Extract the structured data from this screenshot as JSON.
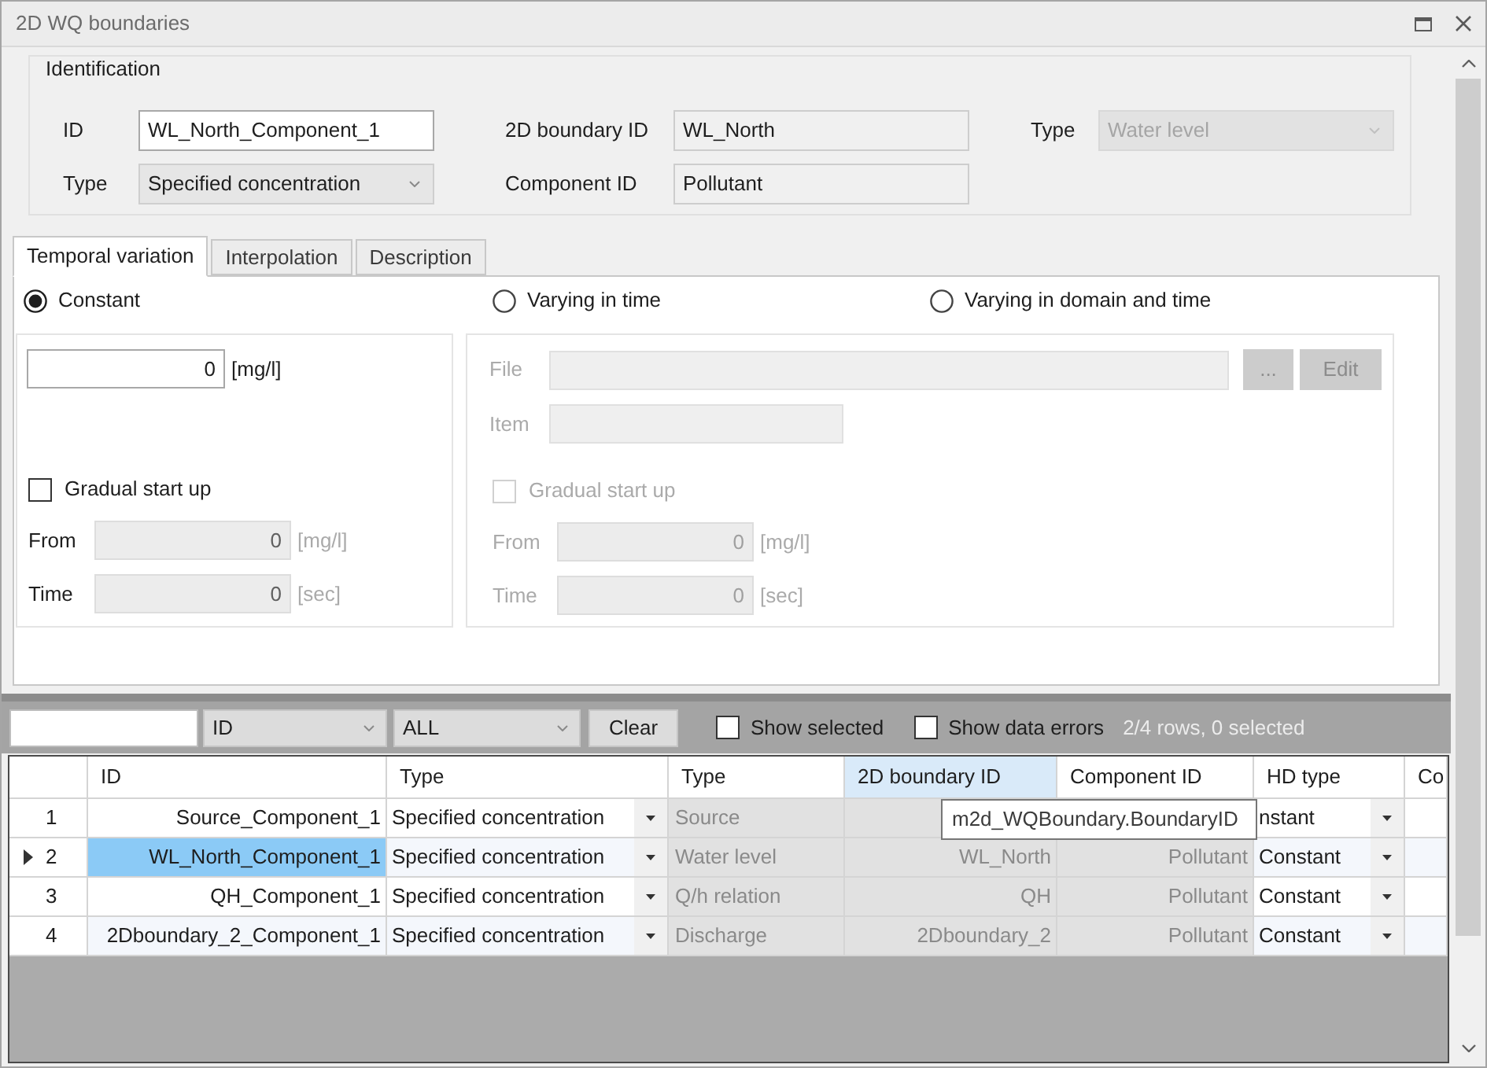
{
  "window": {
    "title": "2D WQ boundaries"
  },
  "identification": {
    "title": "Identification",
    "rows": [
      [
        {
          "label": "ID",
          "kind": "input",
          "value": "WL_North_Component_1"
        },
        {
          "label": "2D boundary ID",
          "kind": "readonly",
          "value": "WL_North"
        },
        {
          "label": "Type",
          "kind": "dropdown",
          "value": "Water level",
          "disabled": true
        }
      ],
      [
        {
          "label": "Type",
          "kind": "dropdown",
          "value": "Specified concentration",
          "disabled": false
        },
        {
          "label": "Component ID",
          "kind": "readonly",
          "value": "Pollutant"
        }
      ]
    ]
  },
  "tabs": [
    {
      "label": "Temporal variation",
      "selected": true
    },
    {
      "label": "Interpolation",
      "selected": false
    },
    {
      "label": "Description",
      "selected": false
    }
  ],
  "variation": {
    "options": [
      {
        "label": "Constant",
        "selected": true
      },
      {
        "label": "Varying in time",
        "selected": false
      },
      {
        "label": "Varying in domain and time",
        "selected": false
      }
    ],
    "constant": {
      "disabled": false,
      "value": "0",
      "unit": "[mg/l]",
      "gradual": {
        "label": "Gradual start up",
        "checked": false
      },
      "startup": [
        {
          "label": "From",
          "value": "0",
          "unit": "[mg/l]",
          "disabled": true
        },
        {
          "label": "Time",
          "value": "0",
          "unit": "[sec]",
          "disabled": true
        }
      ]
    },
    "varying": {
      "disabled": true,
      "file": {
        "label": "File"
      },
      "browse": "...",
      "edit": "Edit",
      "item": {
        "label": "Item"
      },
      "gradual": {
        "label": "Gradual start up",
        "checked": false
      },
      "startup": [
        {
          "label": "From",
          "value": "0",
          "unit": "[mg/l]",
          "disabled": true
        },
        {
          "label": "Time",
          "value": "0",
          "unit": "[sec]",
          "disabled": true
        }
      ]
    }
  },
  "filter": {
    "column": "ID",
    "scope": "ALL",
    "clear": "Clear",
    "toggles": [
      {
        "label": "Show selected",
        "checked": false
      },
      {
        "label": "Show data errors",
        "checked": false
      }
    ],
    "status": "2/4 rows, 0 selected"
  },
  "grid": {
    "columns": [
      {
        "label": "ID",
        "kind": "id",
        "hovered": false
      },
      {
        "label": "Type",
        "kind": "combo",
        "hovered": false
      },
      {
        "label": "Type",
        "kind": "readonly",
        "hovered": false
      },
      {
        "label": "2D boundary ID",
        "kind": "readonly_id",
        "hovered": true
      },
      {
        "label": "Component ID",
        "kind": "readonly_id",
        "hovered": false
      },
      {
        "label": "HD type",
        "kind": "combo",
        "hovered": false
      },
      {
        "label": "Co",
        "kind": "blank",
        "hovered": false
      }
    ],
    "rows": [
      {
        "number": "1",
        "current": false,
        "cells": [
          "Source_Component_1",
          "Specified concentration",
          "Source",
          null,
          null,
          "nstant"
        ]
      },
      {
        "number": "2",
        "current": true,
        "cells": [
          "WL_North_Component_1",
          "Specified concentration",
          "Water level",
          "WL_North",
          "Pollutant",
          "Constant"
        ]
      },
      {
        "number": "3",
        "current": false,
        "cells": [
          "QH_Component_1",
          "Specified concentration",
          "Q/h relation",
          "QH",
          "Pollutant",
          "Constant"
        ]
      },
      {
        "number": "4",
        "current": false,
        "cells": [
          "2Dboundary_2_Component_1",
          "Specified concentration",
          "Discharge",
          "2Dboundary_2",
          "Pollutant",
          "Constant"
        ]
      }
    ],
    "tooltip": "m2d_WQBoundary.BoundaryID"
  }
}
